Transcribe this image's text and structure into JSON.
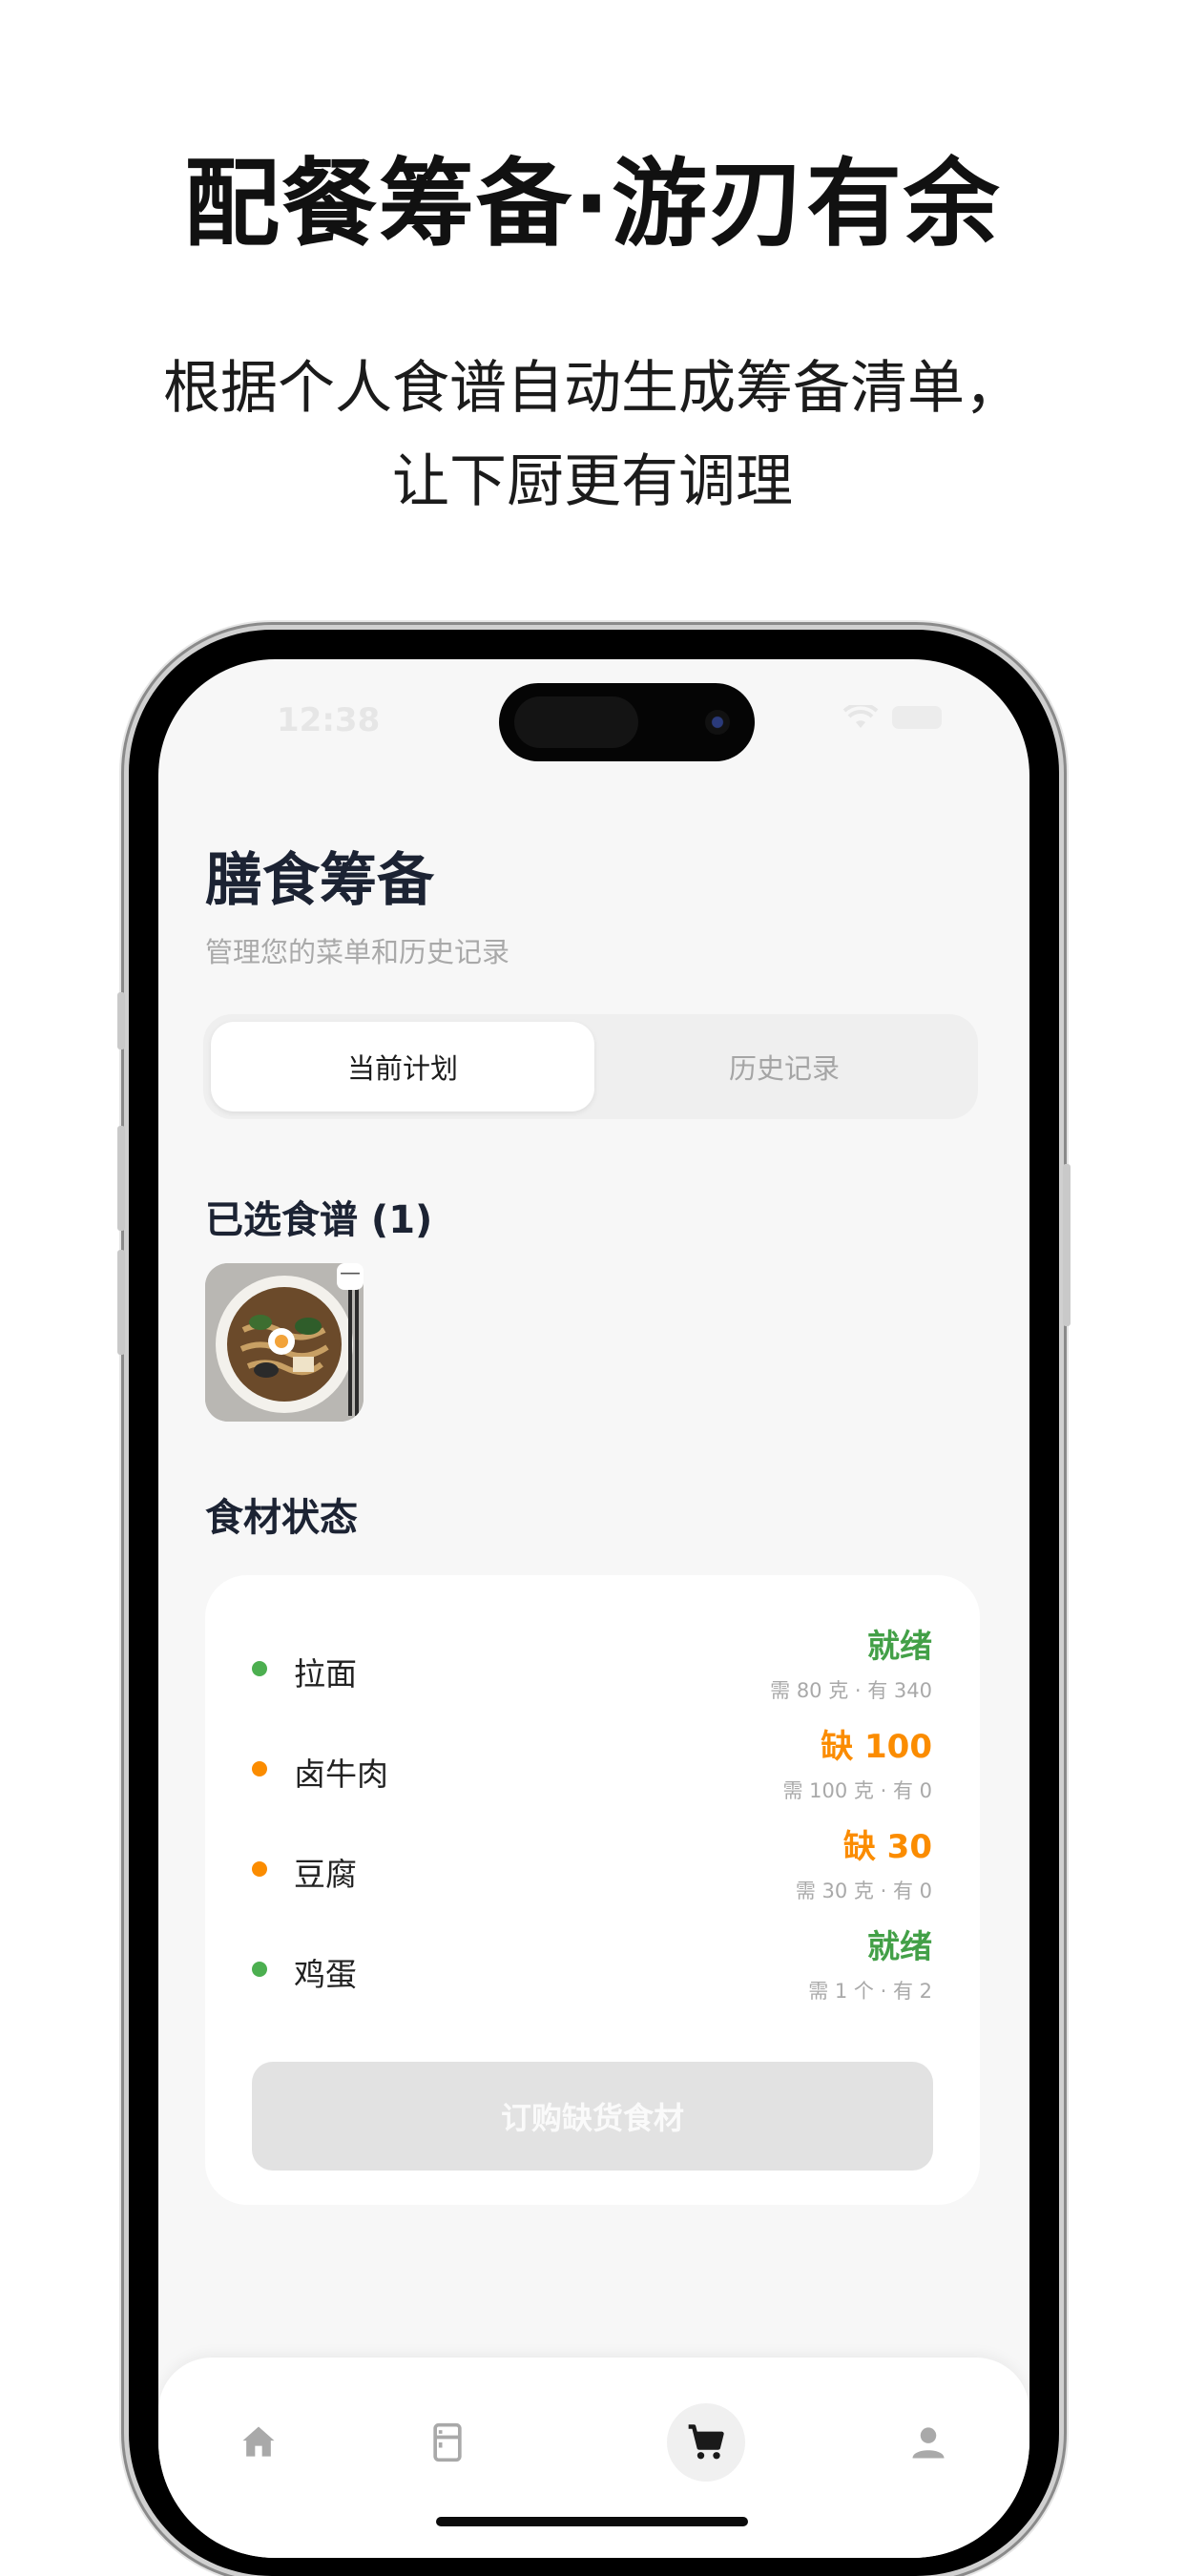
{
  "hero": {
    "headline": "配餐筹备·游刃有余",
    "subline_1": "根据个人食谱自动生成筹备清单，",
    "subline_2": "让下厨更有调理"
  },
  "status_bar": {
    "time": "12:38"
  },
  "header": {
    "title": "膳食筹备",
    "subtitle": "管理您的菜单和历史记录"
  },
  "tabs": {
    "current": "当前计划",
    "history": "历史记录",
    "active": "current"
  },
  "selected_recipes": {
    "title": "已选食谱 (1)",
    "remove_symbol": "—"
  },
  "ingredients": {
    "title": "食材状态",
    "items": [
      {
        "name": "拉面",
        "status": "就绪",
        "detail": "需 80 克 · 有 340",
        "state": "ready"
      },
      {
        "name": "卤牛肉",
        "status": "缺 100",
        "detail": "需 100 克 · 有 0",
        "state": "missing"
      },
      {
        "name": "豆腐",
        "status": "缺 30",
        "detail": "需 30 克 · 有 0",
        "state": "missing"
      },
      {
        "name": "鸡蛋",
        "status": "就绪",
        "detail": "需 1 个 · 有 2",
        "state": "ready"
      }
    ],
    "order_button": "订购缺货食材"
  },
  "tabbar": {
    "items": [
      "home-icon",
      "fridge-icon",
      "cart-icon",
      "profile-icon"
    ],
    "active_index": 2
  },
  "colors": {
    "ready": "#43a047",
    "missing": "#fb8c00",
    "title": "#1c2333"
  }
}
